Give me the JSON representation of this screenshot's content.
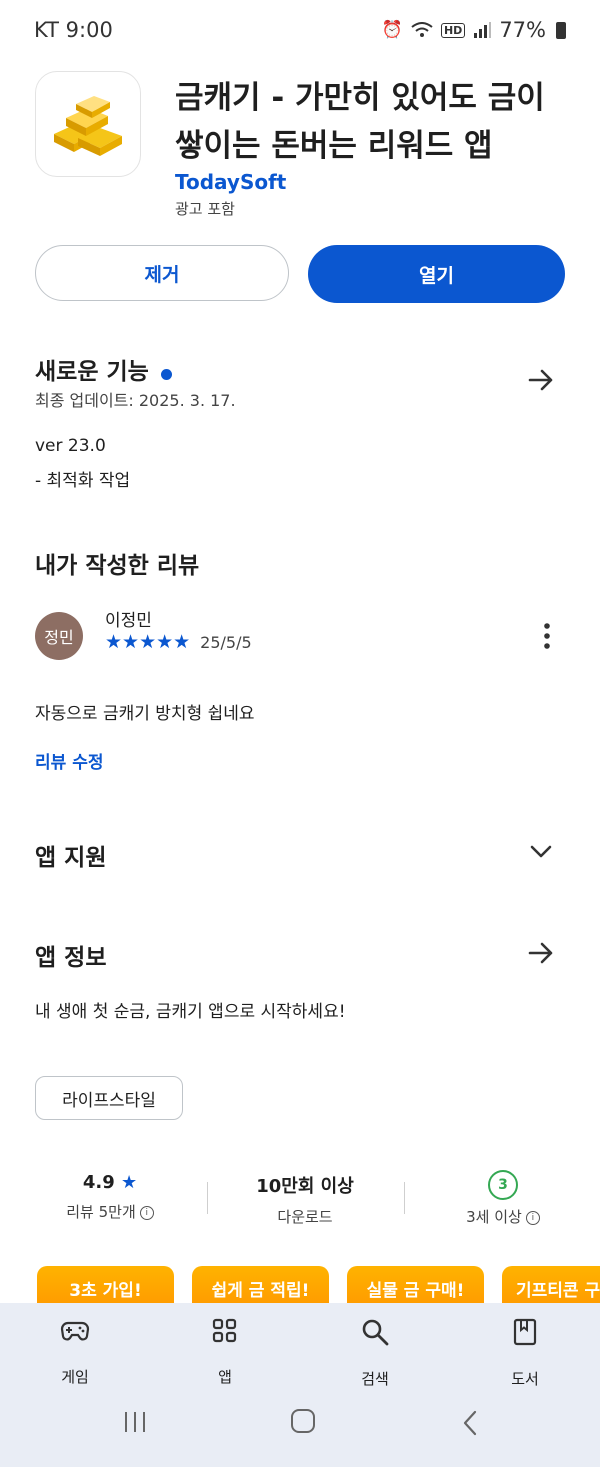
{
  "status_bar": {
    "carrier_time": "KT 9:00",
    "battery": "77%"
  },
  "app": {
    "title": "금캐기 - 가만히 있어도 금이 쌓이는 돈버는 리워드 앱",
    "developer": "TodaySoft",
    "ads_label": "광고 포함",
    "uninstall_label": "제거",
    "open_label": "열기"
  },
  "whats_new": {
    "title": "새로운 기능",
    "updated": "최종 업데이트: 2025. 3. 17.",
    "version": "ver 23.0",
    "note": "- 최적화 작업"
  },
  "my_review": {
    "title": "내가 작성한 리뷰",
    "avatar_text": "정민",
    "author": "이정민",
    "stars": "★★★★★",
    "date": "25/5/5",
    "text": "자동으로 금캐기 방치형 쉽네요",
    "edit_label": "리뷰 수정"
  },
  "app_support": {
    "title": "앱 지원"
  },
  "app_info": {
    "title": "앱 정보",
    "description": "내 생애 첫 순금, 금캐기 앱으로 시작하세요!",
    "category_chip": "라이프스타일"
  },
  "stats": {
    "rating": "4.9",
    "rating_star": "★",
    "reviews": "리뷰 5만개",
    "downloads": "10만회 이상",
    "downloads_label": "다운로드",
    "age_badge": "3",
    "age_label": "3세 이상"
  },
  "promos": [
    "3초 가입!",
    "쉽게 금 적립!",
    "실물 금 구매!",
    "기프티콘 구"
  ],
  "bottom_nav": [
    {
      "label": "게임",
      "icon": "gamepad-icon"
    },
    {
      "label": "앱",
      "icon": "apps-grid-icon"
    },
    {
      "label": "검색",
      "icon": "search-icon"
    },
    {
      "label": "도서",
      "icon": "book-icon"
    }
  ],
  "colors": {
    "accent": "#0b57d0",
    "nav_bg": "#e9edf5",
    "age_green": "#34a853"
  }
}
